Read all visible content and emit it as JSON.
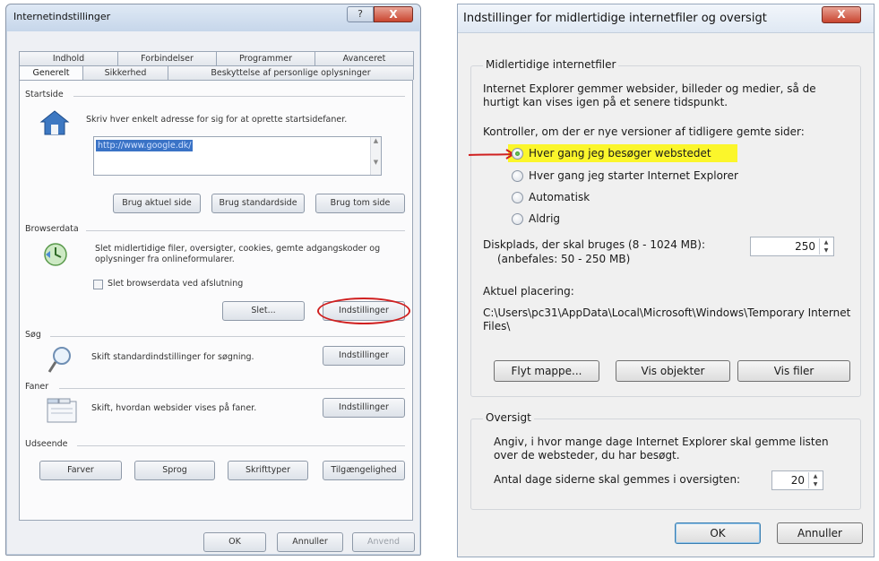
{
  "left_dialog": {
    "title": "Internetindstillinger",
    "help_glyph": "?",
    "close_glyph": "X",
    "tabs_row1": [
      "Indhold",
      "Forbindelser",
      "Programmer",
      "Avanceret"
    ],
    "tabs_row2": [
      "Generelt",
      "Sikkerhed",
      "Beskyttelse af personlige oplysninger"
    ],
    "startside": {
      "label": "Startside",
      "description": "Skriv hver enkelt adresse for sig for at oprette startsidefaner.",
      "url": "http://www.google.dk/",
      "btn_current": "Brug aktuel side",
      "btn_default": "Brug standardside",
      "btn_blank": "Brug tom side"
    },
    "browserdata": {
      "label": "Browserdata",
      "description": "Slet midlertidige filer, oversigter, cookies, gemte adgangskoder og oplysninger fra onlineformularer.",
      "checkbox_label": "Slet browserdata ved afslutning",
      "btn_delete": "Slet...",
      "btn_settings": "Indstillinger"
    },
    "sog": {
      "label": "Søg",
      "description": "Skift standardindstillinger for søgning.",
      "btn_settings": "Indstillinger"
    },
    "faner": {
      "label": "Faner",
      "description": "Skift, hvordan websider vises på faner.",
      "btn_settings": "Indstillinger"
    },
    "udseende": {
      "label": "Udseende",
      "buttons": [
        "Farver",
        "Sprog",
        "Skrifttyper",
        "Tilgængelighed"
      ]
    },
    "footer": {
      "ok": "OK",
      "cancel": "Annuller",
      "apply": "Anvend"
    }
  },
  "right_dialog": {
    "title": "Indstillinger for midlertidige internetfiler og oversigt",
    "close_glyph": "X",
    "temp_files": {
      "label": "Midlertidige internetfiler",
      "description": "Internet Explorer gemmer websider, billeder og medier, så de hurtigt kan vises igen på et senere tidspunkt.",
      "check_prompt": "Kontroller, om der er nye versioner af tidligere gemte sider:",
      "options": [
        {
          "label": "Hver gang jeg besøger webstedet",
          "selected": true,
          "highlighted": true
        },
        {
          "label": "Hver gang jeg starter Internet Explorer",
          "selected": false
        },
        {
          "label": "Automatisk",
          "selected": false
        },
        {
          "label": "Aldrig",
          "selected": false
        }
      ],
      "disk_label_1": "Diskplads, der skal bruges (8 - 1024 MB):",
      "disk_label_2": "(anbefales: 50 - 250 MB)",
      "disk_value": "250",
      "location_label": "Aktuel placering:",
      "location_value": "C:\\Users\\pc31\\AppData\\Local\\Microsoft\\Windows\\Temporary Internet Files\\",
      "btn_move": "Flyt mappe...",
      "btn_objects": "Vis objekter",
      "btn_files": "Vis filer"
    },
    "history": {
      "label": "Oversigt",
      "description": "Angiv, i hvor mange dage Internet Explorer skal gemme listen over de websteder, du har besøgt.",
      "days_label": "Antal dage siderne skal gemmes i oversigten:",
      "days_value": "20"
    },
    "footer": {
      "ok": "OK",
      "cancel": "Annuller"
    }
  },
  "colors": {
    "highlight": "#fbf62b",
    "annotation_red": "#d02020",
    "accent_blue": "#3a73c6"
  }
}
